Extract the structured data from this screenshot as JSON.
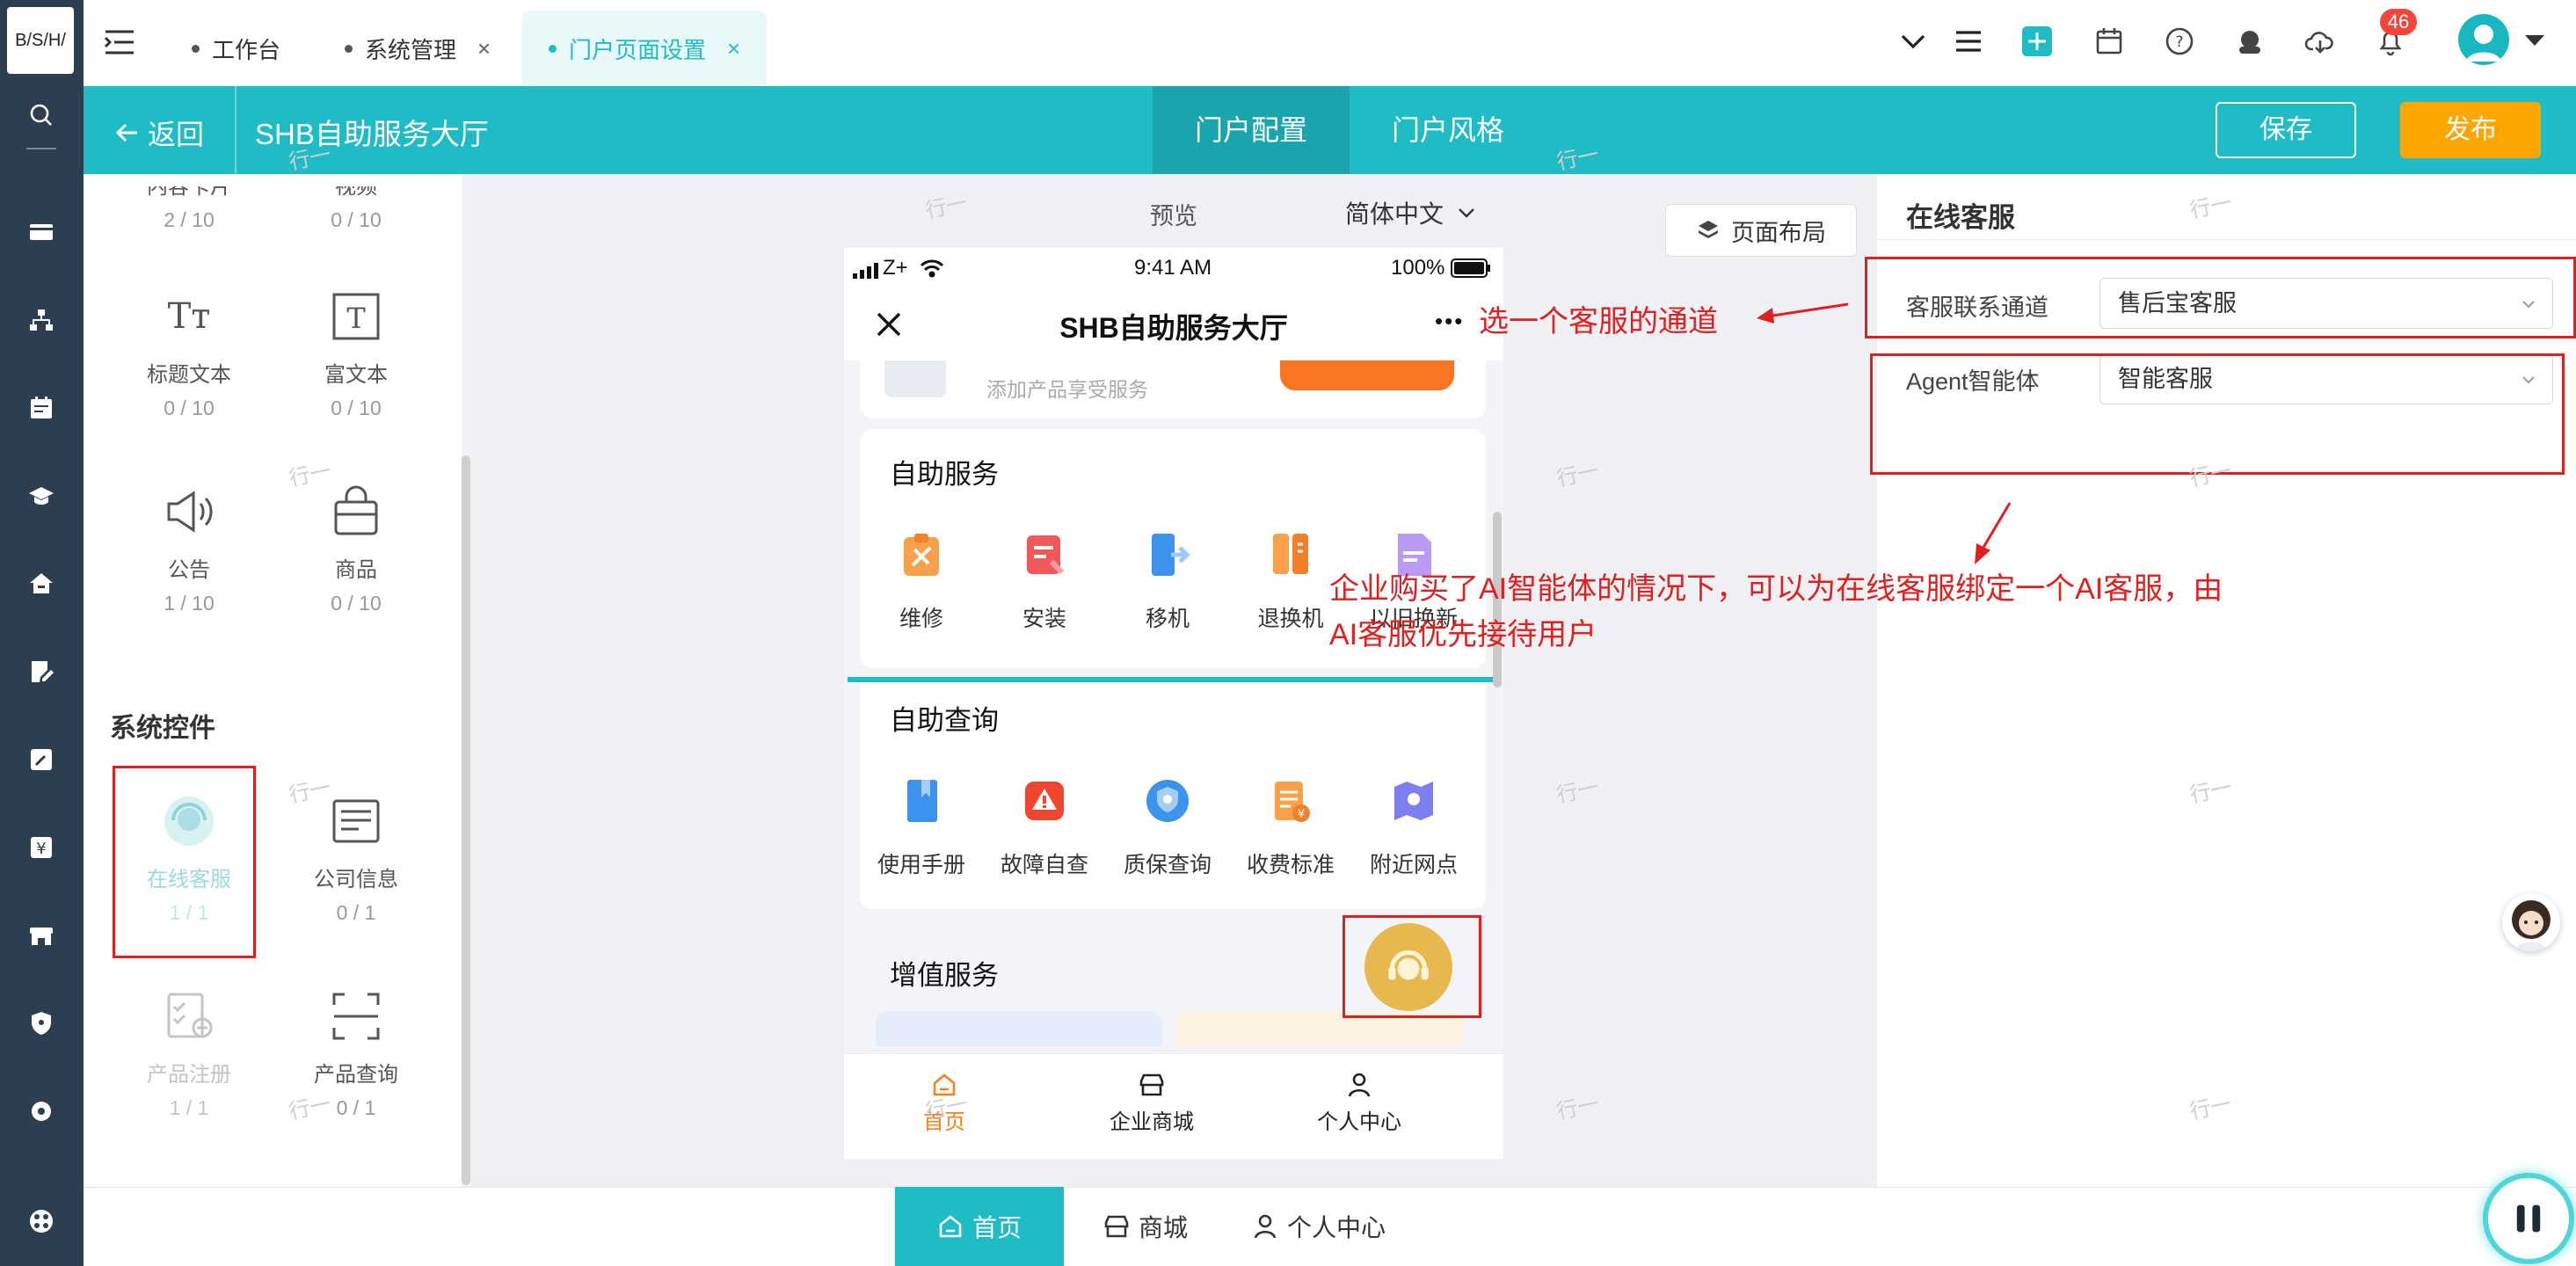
{
  "logo": "B/S/H/",
  "tabs": [
    {
      "label": "工作台",
      "closable": false
    },
    {
      "label": "系统管理",
      "closable": true
    },
    {
      "label": "门户页面设置",
      "closable": true
    }
  ],
  "tab_close_glyph": "×",
  "notifications_count": "46",
  "header": {
    "back_label": "返回",
    "title": "SHB自助服务大厅",
    "tabs": [
      "门户配置",
      "门户风格"
    ],
    "save_label": "保存",
    "publish_label": "发布"
  },
  "palette": {
    "items_top": [
      {
        "name": "内容卡片",
        "count": "2 / 10"
      },
      {
        "name": "视频",
        "count": "0 / 10"
      },
      {
        "name": "标题文本",
        "count": "0 / 10"
      },
      {
        "name": "富文本",
        "count": "0 / 10"
      },
      {
        "name": "公告",
        "count": "1 / 10"
      },
      {
        "name": "商品",
        "count": "0 / 10"
      }
    ],
    "system_title": "系统控件",
    "items_system": [
      {
        "name": "在线客服",
        "count": "1 / 1"
      },
      {
        "name": "公司信息",
        "count": "0 / 1"
      },
      {
        "name": "产品注册",
        "count": "1 / 1"
      },
      {
        "name": "产品查询",
        "count": "0 / 1"
      }
    ]
  },
  "canvas": {
    "preview_label": "预览",
    "language": "简体中文",
    "layout_button": "页面布局"
  },
  "phone": {
    "carrier": "Z+",
    "time": "9:41 AM",
    "battery": "100%",
    "title": "SHB自助服务大厅",
    "more_glyph": "•••",
    "register_hint": "添加产品享受服务",
    "sections": [
      {
        "title": "自助服务",
        "items": [
          "维修",
          "安装",
          "移机",
          "退换机",
          "以旧换新"
        ]
      },
      {
        "title": "自助查询",
        "items": [
          "使用手册",
          "故障自查",
          "质保查询",
          "收费标准",
          "附近网点"
        ]
      },
      {
        "title": "增值服务",
        "items": []
      }
    ],
    "bottom_nav": [
      "首页",
      "企业商城",
      "个人中心"
    ]
  },
  "props": {
    "title": "在线客服",
    "fields": [
      {
        "label": "客服联系通道",
        "value": "售后宝客服"
      },
      {
        "label": "Agent智能体",
        "value": "智能客服"
      }
    ]
  },
  "bottom_bar": [
    "首页",
    "商城",
    "个人中心"
  ],
  "annotations": {
    "channel": "选一个客服的通道",
    "agent_line1": "企业购买了AI智能体的情况下，可以为在线客服绑定一个AI客服，由",
    "agent_line2": "AI客服优先接待用户"
  },
  "watermark": "行一",
  "colors": {
    "accent": "#1fbcc6",
    "publish": "#ffa500",
    "annotation": "#e02020",
    "tab_active_bg": "#e9f8f9"
  }
}
